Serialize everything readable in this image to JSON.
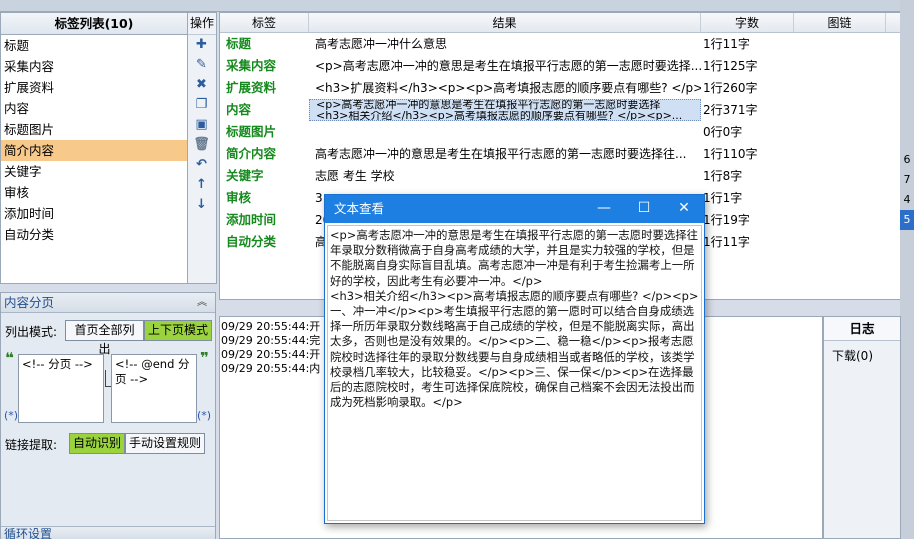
{
  "left_panel": {
    "title": "标签列表(10)",
    "items": [
      "标题",
      "采集内容",
      "扩展资料",
      "内容",
      "标题图片",
      "简介内容",
      "关键字",
      "审核",
      "添加时间",
      "自动分类"
    ],
    "selected_index": 5
  },
  "ops": {
    "title": "操作",
    "buttons": [
      "add-icon",
      "edit-icon",
      "delete-icon",
      "copy-icon",
      "paste-icon",
      "trash-icon",
      "undo-icon",
      "up-arrow-icon",
      "down-arrow-icon"
    ]
  },
  "table": {
    "headers": [
      "标签",
      "结果",
      "字数",
      "图链"
    ],
    "rows": [
      {
        "name": "标题",
        "result": "高考志愿冲一冲什么意思",
        "count": "1行11字"
      },
      {
        "name": "采集内容",
        "result": "<p>高考志愿冲一冲的意思是考生在填报平行志愿的第一志愿时要选择...",
        "count": "1行125字"
      },
      {
        "name": "扩展资料",
        "result": "<h3>扩展资料</h3><p><p>高考填报志愿的顺序要点有哪些? </p><p>...",
        "count": "1行260字"
      },
      {
        "name": "内容",
        "result": "<p>高考志愿冲一冲的意思是考生在填报平行志愿的第一志愿时要选择",
        "result2": "<h3>相关介绍</h3><p>高考填报志愿的顺序要点有哪些? </p><p>...",
        "count": "2行371字"
      },
      {
        "name": "标题图片",
        "result": "",
        "count": "0行0字"
      },
      {
        "name": "简介内容",
        "result": "高考志愿冲一冲的意思是考生在填报平行志愿的第一志愿时要选择往...",
        "count": "1行110字"
      },
      {
        "name": "关键字",
        "result": "志愿 考生 学校",
        "count": "1行8字"
      },
      {
        "name": "审核",
        "result": "3",
        "count": "1行1字"
      },
      {
        "name": "添加时间",
        "result": "20",
        "count": "1行19字"
      },
      {
        "name": "自动分类",
        "result": "高",
        "count": "1行11字"
      }
    ]
  },
  "paging": {
    "title": "内容分页",
    "list_mode_label": "列出模式:",
    "mode_first": "首页全部列出",
    "mode_next": "上下页模式",
    "start_text": "<!-- 分页 -->",
    "end_text": "<!-- @end 分页 -->",
    "link_label": "链接提取:",
    "link_auto": "自动识别",
    "link_manual": "手动设置规则",
    "loop_title": "循环设置"
  },
  "log": {
    "lines": [
      "09/29 20:55:44:开",
      "09/29 20:55:44:完",
      "09/29 20:55:44:开",
      "09/29 20:55:44:内"
    ]
  },
  "sidebox": {
    "title": "日志",
    "item": "下载(0)"
  },
  "right_edge": {
    "numbers": [
      "6",
      "7",
      "4",
      "5"
    ]
  },
  "modal": {
    "title": "文本查看",
    "text": "<p>高考志愿冲一冲的意思是考生在填报平行志愿的第一志愿时要选择往年录取分数稍微高于自身高考成绩的大学，并且是实力较强的学校，但是不能脱离自身实际盲目乱填。高考志愿冲一冲是有利于考生捡漏考上一所好的学校，因此考生有必要冲一冲。</p>\n<h3>相关介绍</h3><p>高考填报志愿的顺序要点有哪些? </p><p>一、冲一冲</p><p>考生填报平行志愿的第一愿时可以结合自身成绩选择一所历年录取分数线略高于自己成绩的学校，但是不能脱离实际，高出太多，否则也是没有效果的。</p><p>二、稳一稳</p><p>报考志愿院校时选择往年的录取分数线要与自身成绩相当或者略低的学校，该类学校录档几率较大，比较稳妥。</p><p>三、保一保</p><p>在选择最后的志愿院校时，考生可选择保底院校，确保自己档案不会因无法投出而成为死档影响录取。</p>"
  }
}
